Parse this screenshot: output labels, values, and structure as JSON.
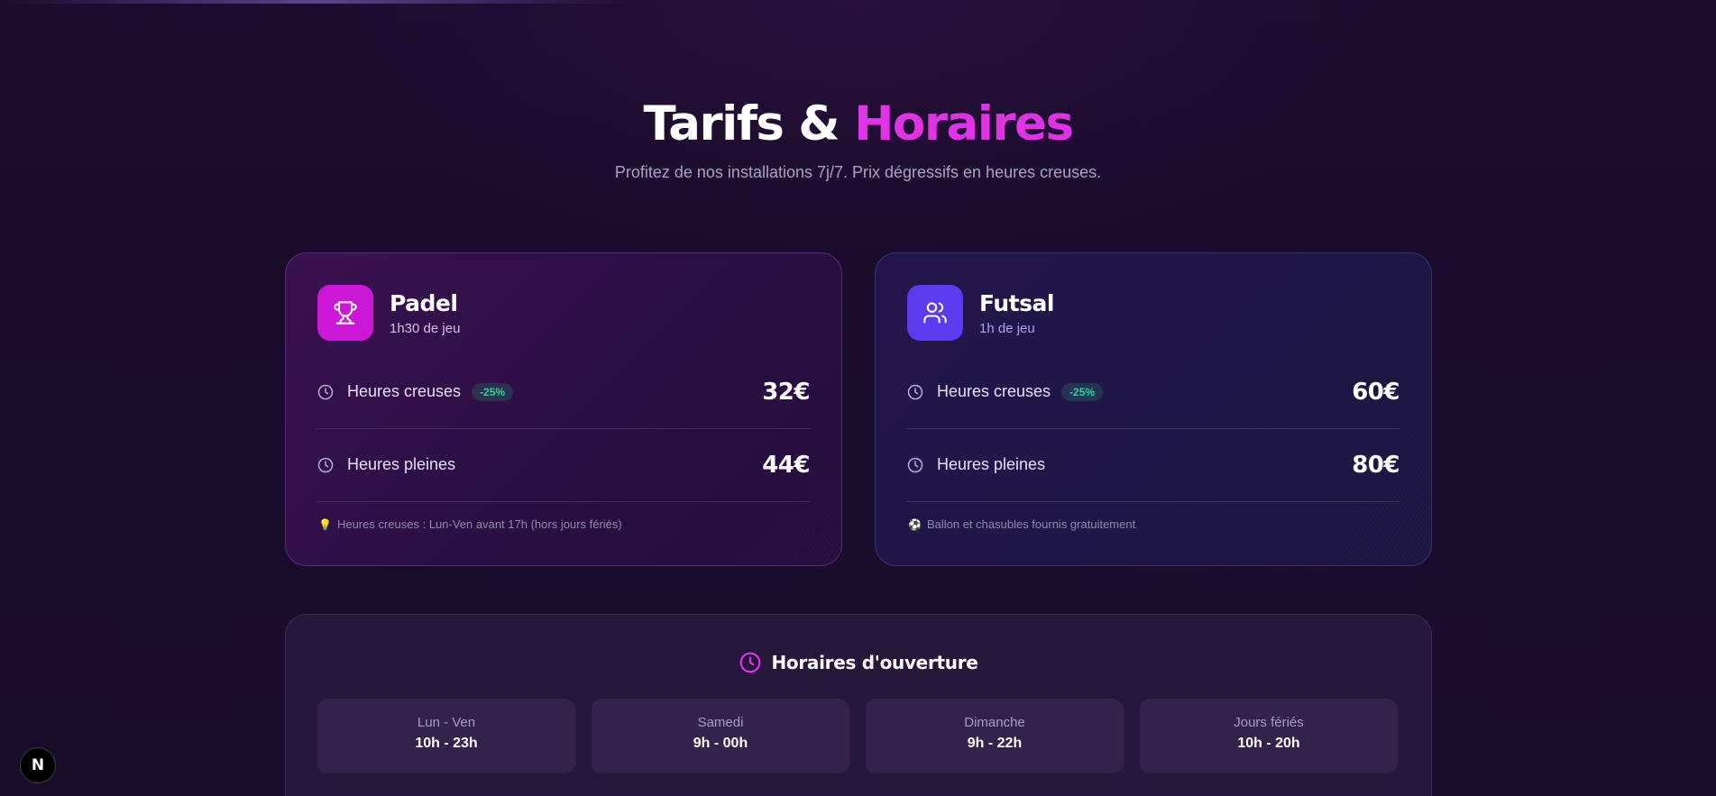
{
  "header": {
    "title_main": "Tarifs &",
    "title_accent": "Horaires",
    "subtitle": "Profitez de nos installations 7j/7. Prix dégressifs en heures creuses."
  },
  "cards": [
    {
      "icon": "trophy-icon",
      "title": "Padel",
      "duration": "1h30 de jeu",
      "rows": [
        {
          "label": "Heures creuses",
          "badge": "-25%",
          "price": "32€"
        },
        {
          "label": "Heures pleines",
          "price": "44€"
        }
      ],
      "note_emoji": "💡",
      "note": "Heures creuses : Lun-Ven avant 17h (hors jours fériés)"
    },
    {
      "icon": "users-icon",
      "title": "Futsal",
      "duration": "1h de jeu",
      "rows": [
        {
          "label": "Heures creuses",
          "badge": "-25%",
          "price": "60€"
        },
        {
          "label": "Heures pleines",
          "price": "80€"
        }
      ],
      "note_emoji": "⚽",
      "note": "Ballon et chasubles fournis gratuitement"
    }
  ],
  "hours": {
    "title": "Horaires d'ouverture",
    "items": [
      {
        "day": "Lun - Ven",
        "time": "10h - 23h"
      },
      {
        "day": "Samedi",
        "time": "9h - 00h"
      },
      {
        "day": "Dimanche",
        "time": "9h - 22h"
      },
      {
        "day": "Jours fériés",
        "time": "10h - 20h"
      }
    ]
  },
  "dev_badge": {
    "letter": "N"
  },
  "colors": {
    "accent": "#e232e8",
    "padel_icon_bg": "#cc17d6",
    "futsal_icon_bg": "#5b3bf0",
    "badge_green": "#2fd39a",
    "background": "#1a0c2b"
  }
}
